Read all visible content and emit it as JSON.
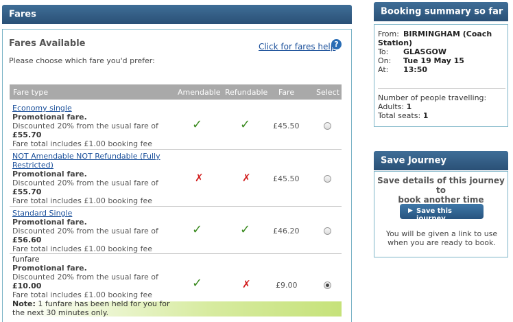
{
  "fares_header": "Fares",
  "fares": {
    "title": "Fares Available",
    "subtitle": "Please choose which fare you'd prefer:",
    "help_link": "Click for fares help",
    "help_icon": "?",
    "columns": [
      "Fare type",
      "Amendable",
      "Refundable",
      "Fare",
      "Select"
    ],
    "rows": [
      {
        "name": "Economy single",
        "name_line2": "",
        "promo": "Promotional fare.",
        "discount": "Discounted 20% from the usual fare of",
        "usual": "£55.70",
        "booking_fee": "Fare total includes £1.00 booking fee",
        "amendable": "✓",
        "refundable": "✓",
        "fare": "£45.50",
        "selected": false
      },
      {
        "name": "NOT Amendable NOT Refundable (Fully",
        "name_line2": "Restricted)",
        "promo": "Promotional fare.",
        "discount": "Discounted 20% from the usual fare of",
        "usual": "£55.70",
        "booking_fee": "Fare total includes £1.00 booking fee",
        "amendable": "✗",
        "refundable": "✗",
        "fare": "£45.50",
        "selected": false
      },
      {
        "name": "Standard Single",
        "name_line2": "",
        "promo": "Promotional fare.",
        "discount": "Discounted 20% from the usual fare of",
        "usual": "£56.60",
        "booking_fee": "Fare total includes £1.00 booking fee",
        "amendable": "✓",
        "refundable": "✓",
        "fare": "£46.20",
        "selected": false
      },
      {
        "name": "funfare",
        "name_line2": "",
        "promo": "Promotional fare.",
        "discount": "Discounted 20% from the usual fare of",
        "usual": "£10.00",
        "booking_fee": "Fare total includes £1.00 booking fee",
        "amendable": "✓",
        "refundable": "✗",
        "fare": "£9.00",
        "selected": true,
        "note_label": "Note:",
        "note_text": " 1 funfare has been held for you for",
        "note_text2": "the next 30 minutes only."
      }
    ]
  },
  "booking_summary": {
    "header": "Booking summary so far",
    "from_label": "From:",
    "from_value": "BIRMINGHAM (Coach",
    "from_value2": "Station)",
    "to_label": "To:",
    "to_value": "GLASGOW",
    "on_label": "On:",
    "on_value": "Tue 19 May 15",
    "at_label": "At:",
    "at_value": "13:50",
    "people_label": "Number of people travelling:",
    "adults_label": "Adults:",
    "adults_value": "1",
    "seats_label": "Total seats:",
    "seats_value": "1"
  },
  "save_journey": {
    "header": "Save Journey",
    "title_line1": "Save details of this journey to",
    "title_line2": "book another time",
    "button": "Save this journey",
    "info_line1": "You will be given a link to use",
    "info_line2": "when you are ready to book."
  },
  "colors": {
    "header_blue": "#2f5b84",
    "panel_border": "#7ab3c6",
    "tick_green": "#3a8a1f",
    "cross_red": "#d21d1d",
    "link_blue": "#1a4f9a",
    "note_highlight": "#c6e27a"
  }
}
